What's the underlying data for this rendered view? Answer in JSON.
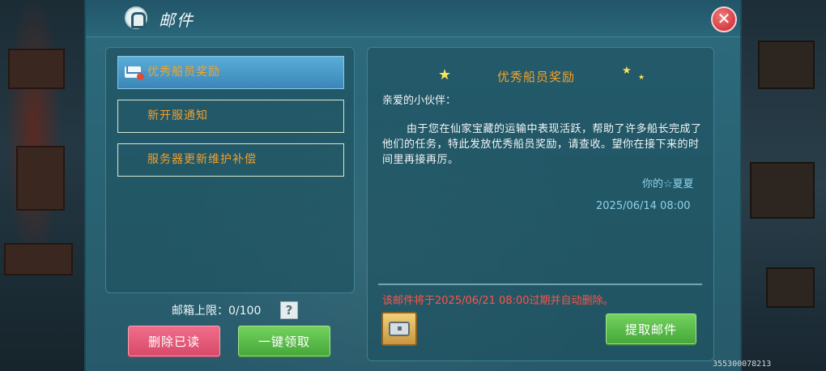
{
  "window": {
    "title": "邮件",
    "close_label": "✕"
  },
  "mail_list": {
    "items": [
      {
        "label": "优秀船员奖励",
        "selected": true
      },
      {
        "label": "新开服通知",
        "selected": false
      },
      {
        "label": "服务器更新维护补偿",
        "selected": false
      }
    ]
  },
  "footer": {
    "capacity": "邮箱上限：0/100",
    "help_label": "?",
    "delete_read_label": "删除已读",
    "claim_all_label": "一键领取"
  },
  "detail": {
    "title": "优秀船员奖励",
    "greeting": "亲爱的小伙伴：",
    "body": "由于您在仙家宝藏的运输中表现活跃，帮助了许多船长完成了他们的任务，特此发放优秀船员奖励，请查收。望你在接下来的时间里再接再厉。",
    "signature": "你的☆夏夏",
    "date": "2025/06/14 08:00",
    "expire_notice": "该邮件将于2025/06/21 08:00过期并自动删除。",
    "claim_label": "提取邮件"
  },
  "player_id": "35530007821З",
  "colors": {
    "accent_orange": "#f5a32a",
    "link_blue": "#8ed2ea",
    "warning_red": "#ff5346",
    "button_green": "#45a83a",
    "button_red": "#d8496a"
  }
}
